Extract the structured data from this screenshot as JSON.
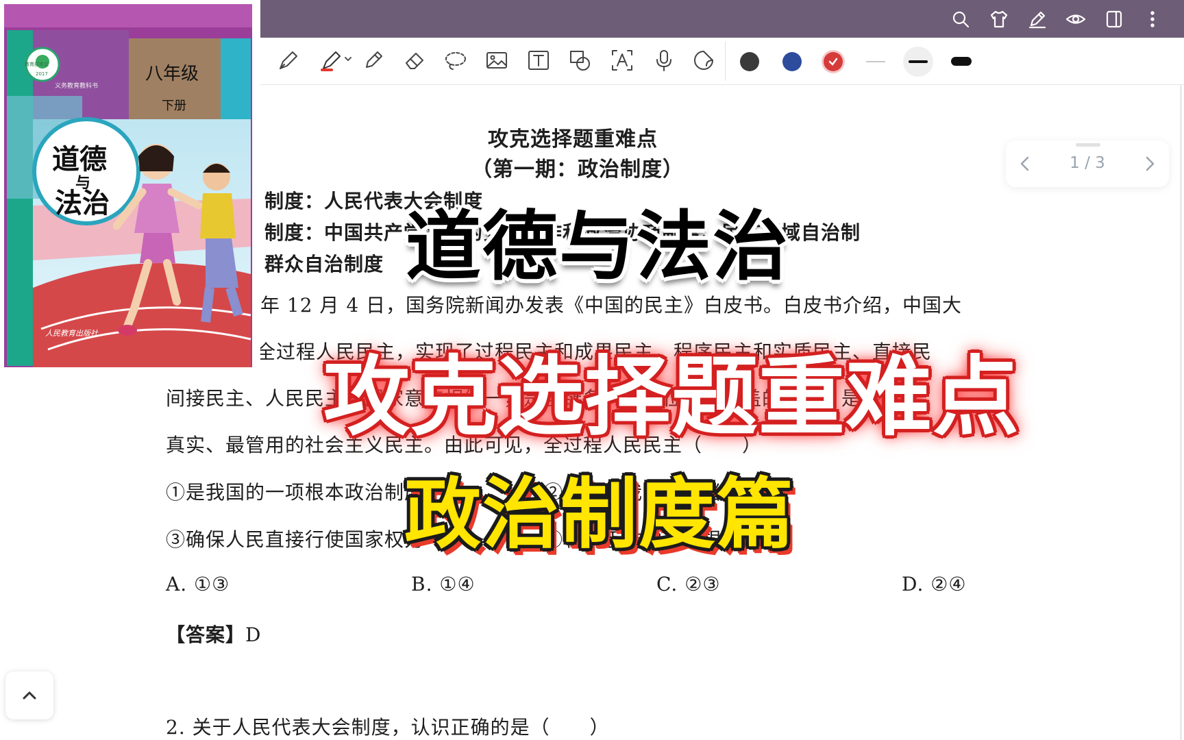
{
  "topbar": {
    "icons": [
      "search-icon",
      "shirt-icon",
      "pen-edit-icon",
      "eye-icon",
      "sidebar-icon",
      "more-vertical-icon"
    ]
  },
  "toolbar": {
    "tools": [
      "fountain-pen-icon",
      "highlighter-icon",
      "marker-icon",
      "eraser-icon",
      "lasso-icon",
      "image-icon",
      "text-icon",
      "shapes-icon",
      "text-recognition-icon",
      "microphone-icon",
      "sticker-icon"
    ],
    "colors": [
      "#3a3a3a",
      "#2e4c9c",
      "#d63b3b"
    ],
    "selected_color": "#d63b3b",
    "accent_highlighter": "#e8352d"
  },
  "pager": {
    "page": "1 / 3"
  },
  "book": {
    "grade": "八年级",
    "volume": "下册",
    "title_line1": "道德",
    "title_conj": "与",
    "title_line2": "法治",
    "badge_top": "教育部审定",
    "badge_year": "2017",
    "series": "义务教育教科书",
    "publisher": "人民教育出版社"
  },
  "document": {
    "title": "攻克选择题重难点",
    "subtitle": "（第一期：政治制度）",
    "lines": [
      "制度：人民代表大会制度",
      "制度：中国共产党领导的多党合作和政治协商制度、民族区域自治制",
      "群众自治制度",
      "年 12 月 4 日，国务院新闻办发表《中国的民主》白皮书。白皮书介绍，中国大",
      "全过程人民民主，实现了过程民主和成果民主、程序民主和实质民主、直接民",
      "间接民主、人民民主和国家意志相统一，是全链条、全方位、全覆盖的民主，是最广",
      "真实、最管用的社会主义民主。由此可见，全过程人民民主（　　）",
      "①是我国的一项根本政治制度　　　　　　②体现了我国人民当家作主",
      "③确保人民直接行使国家权力　　　　　　④有利于维护人民根本利益"
    ],
    "options": [
      "A. ①③",
      "B. ①④",
      "C. ②③",
      "D. ②④"
    ],
    "answer_label": "【答案】",
    "answer_value": "D",
    "q2": "2. 关于人民代表大会制度，认识正确的是（　　）"
  },
  "overlay": {
    "line1": "道德与法治",
    "line2": "攻克选择题重难点",
    "line3": "政治制度篇"
  }
}
